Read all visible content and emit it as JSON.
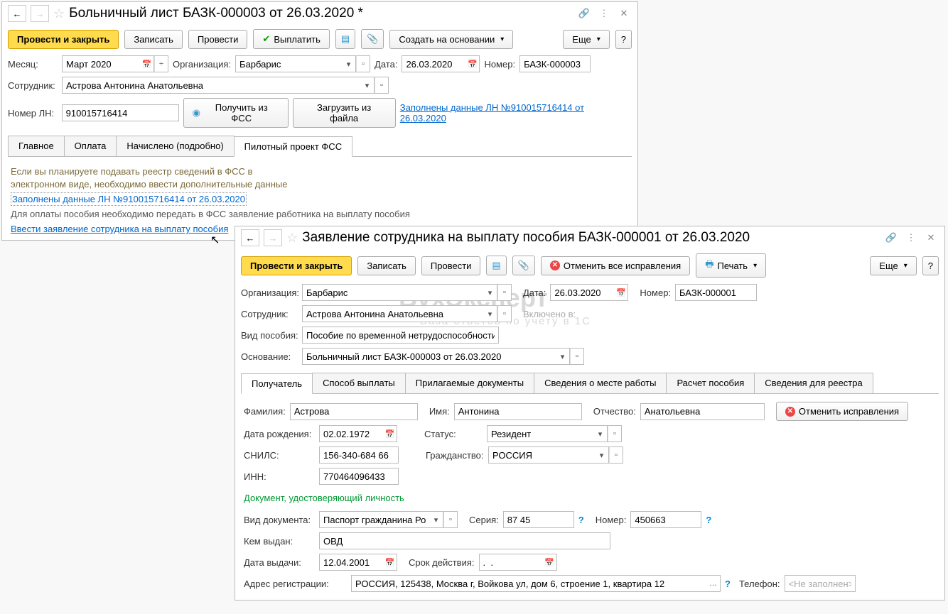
{
  "win1": {
    "title": "Больничный лист БАЗК-000003 от 26.03.2020 *",
    "btn_post_close": "Провести и закрыть",
    "btn_write": "Записать",
    "btn_post": "Провести",
    "btn_pay": "Выплатить",
    "btn_create_based": "Создать на основании",
    "btn_more": "Еще",
    "lbl_month": "Месяц:",
    "val_month": "Март 2020",
    "lbl_org": "Организация:",
    "val_org": "Барбарис",
    "lbl_date": "Дата:",
    "val_date": "26.03.2020",
    "lbl_number": "Номер:",
    "val_number": "БАЗК-000003",
    "lbl_employee": "Сотрудник:",
    "val_employee": "Астрова Антонина Анатольевна",
    "lbl_ln": "Номер ЛН:",
    "val_ln": "910015716414",
    "btn_get_fss": "Получить из ФСС",
    "btn_load_file": "Загрузить из файла",
    "link_ln_data": "Заполнены данные ЛН №910015716414 от 26.03.2020",
    "tabs": [
      "Главное",
      "Оплата",
      "Начислено (подробно)",
      "Пилотный проект ФСС"
    ],
    "info1": "Если вы планируете подавать реестр сведений в ФСС в",
    "info2": "электронном виде, необходимо ввести дополнительные данные",
    "link_ln_data2": "Заполнены данные ЛН №910015716414 от 26.03.2020",
    "info3": "Для оплаты пособия необходимо передать в ФСС заявление работника на выплату пособия",
    "link_app": "Ввести заявление сотрудника на выплату пособия"
  },
  "win2": {
    "title": "Заявление сотрудника на выплату пособия БАЗК-000001 от 26.03.2020",
    "btn_post_close": "Провести и закрыть",
    "btn_write": "Записать",
    "btn_post": "Провести",
    "btn_cancel_corr": "Отменить все исправления",
    "btn_print": "Печать",
    "btn_more": "Еще",
    "lbl_org": "Организация:",
    "val_org": "Барбарис",
    "lbl_date": "Дата:",
    "val_date": "26.03.2020",
    "lbl_number": "Номер:",
    "val_number": "БАЗК-000001",
    "lbl_employee": "Сотрудник:",
    "val_employee": "Астрова Антонина Анатольевна",
    "lbl_included": "Включено в:",
    "lbl_benefit_type": "Вид пособия:",
    "val_benefit_type": "Пособие по временной нетрудоспособности",
    "lbl_basis": "Основание:",
    "val_basis": "Больничный лист БАЗК-000003 от 26.03.2020",
    "tabs": [
      "Получатель",
      "Способ выплаты",
      "Прилагаемые документы",
      "Сведения о месте работы",
      "Расчет пособия",
      "Сведения для реестра"
    ],
    "lbl_lastname": "Фамилия:",
    "val_lastname": "Астрова",
    "lbl_firstname": "Имя:",
    "val_firstname": "Антонина",
    "lbl_patronymic": "Отчество:",
    "val_patronymic": "Анатольевна",
    "btn_cancel_corr2": "Отменить исправления",
    "lbl_birthdate": "Дата рождения:",
    "val_birthdate": "02.02.1972",
    "lbl_status": "Статус:",
    "val_status": "Резидент",
    "lbl_snils": "СНИЛС:",
    "val_snils": "156-340-684 66",
    "lbl_citizenship": "Гражданство:",
    "val_citizenship": "РОССИЯ",
    "lbl_inn": "ИНН:",
    "val_inn": "770464096433",
    "section_doc": "Документ, удостоверяющий личность",
    "lbl_doctype": "Вид документа:",
    "val_doctype": "Паспорт гражданина Росс",
    "lbl_series": "Серия:",
    "val_series": "87 45",
    "lbl_docnum": "Номер:",
    "val_docnum": "450663",
    "lbl_issued_by": "Кем выдан:",
    "val_issued_by": "ОВД",
    "lbl_issue_date": "Дата выдачи:",
    "val_issue_date": "12.04.2001",
    "lbl_validity": "Срок действия:",
    "val_validity": ".  .",
    "lbl_reg_addr": "Адрес регистрации:",
    "val_reg_addr": "РОССИЯ, 125438, Москва г, Войкова ул, дом 6, строение 1, квартира 12",
    "lbl_phone": "Телефон:",
    "val_phone": "<Не заполнен>"
  },
  "watermark": "БухЭксперт",
  "watermark_sub": "База ответов по учету в 1С"
}
